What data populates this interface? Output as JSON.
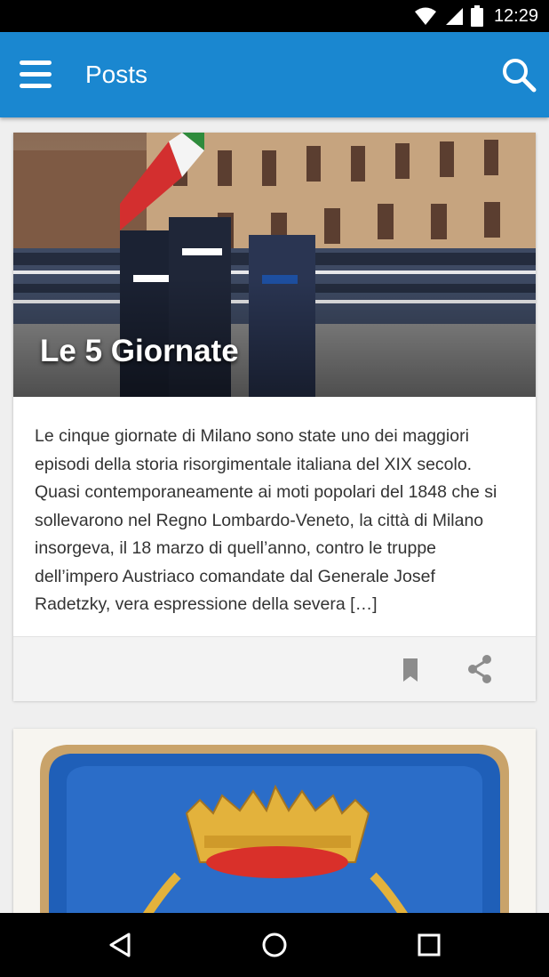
{
  "status_bar": {
    "time": "12:29",
    "icons": [
      "wifi-icon",
      "signal-icon",
      "battery-icon"
    ]
  },
  "app_bar": {
    "title": "Posts",
    "background": "#1a87d0",
    "menu_icon": "hamburger-menu-icon",
    "search_icon": "search-icon"
  },
  "posts": [
    {
      "title": "Le 5 Giornate",
      "excerpt": "Le cinque giornate di Milano sono state uno dei maggiori episodi della storia risorgimentale italiana del XIX secolo. Quasi contemporaneamente ai moti popolari del 1848 che si sollevarono nel Regno Lombardo-Veneto, la città di Milano insorgeva, il 18 marzo di quell’anno, contro le truppe dell’impero Austriaco comandate dal Generale Josef Radetzky, vera espressione della severa […]",
      "image": "military-parade-with-italian-flag",
      "actions": [
        "bookmark-icon",
        "share-icon"
      ]
    },
    {
      "title": "",
      "image": "blue-crest-with-golden-crown"
    }
  ],
  "nav_bar": {
    "icons": [
      "back-icon",
      "home-icon",
      "recents-icon"
    ]
  }
}
